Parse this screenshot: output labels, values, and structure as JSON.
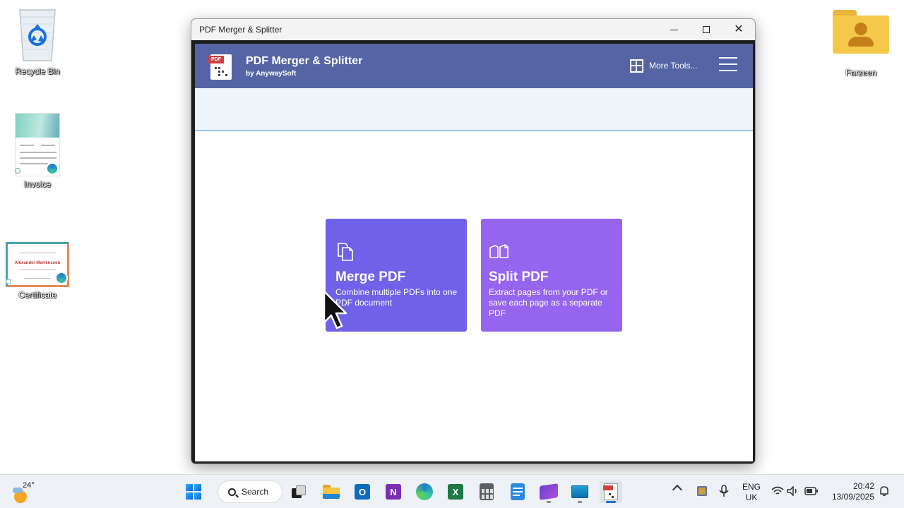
{
  "desktop": {
    "icons": [
      {
        "label": "Recycle Bin"
      },
      {
        "label": "Invoice"
      },
      {
        "label": "Certificate"
      },
      {
        "label": "Farzeen"
      }
    ],
    "certificate_thumb_name": "Alexander Mortensson"
  },
  "window": {
    "title": "PDF Merger & Splitter",
    "logo_tag": "PDF"
  },
  "app": {
    "name": "PDF Merger & Splitter",
    "byline": "by AnywaySoft",
    "more_tools": "More Tools...",
    "cards": [
      {
        "title": "Merge PDF",
        "description": "Combine multiple PDFs into one PDF document",
        "icon": "merge-pages-icon"
      },
      {
        "title": "Split PDF",
        "description": "Extract pages from your PDF or save each page as a separate PDF",
        "icon": "split-pages-icon"
      }
    ]
  },
  "taskbar": {
    "temperature": "24°",
    "search_label": "Search",
    "lang_top": "ENG",
    "lang_bottom": "UK",
    "time": "20:42",
    "date": "13/09/2025"
  },
  "colors": {
    "header": "#5464a4",
    "merge_card": "#7062e8",
    "split_card": "#9565f0",
    "subbar": "#eef6fc"
  }
}
